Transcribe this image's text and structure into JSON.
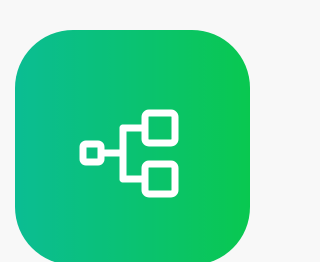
{
  "app_icon": {
    "icon": "hierarchy-icon",
    "colors": {
      "gradient_start": "#0bbd93",
      "gradient_end": "#09c850",
      "glyph": "#ffffff",
      "page_background": "#f8f8f8"
    }
  }
}
